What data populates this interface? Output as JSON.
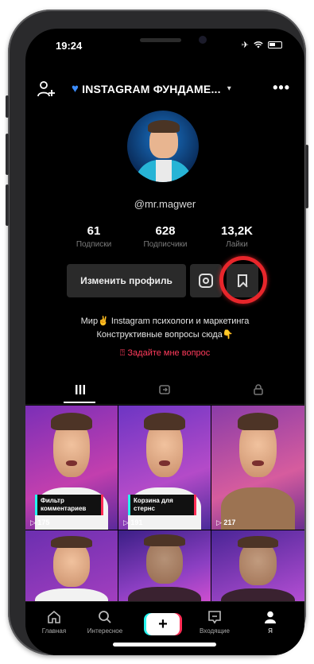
{
  "status_bar": {
    "time": "19:24"
  },
  "header": {
    "title": "INSTAGRAM ФУНДАМЕ...",
    "heart_icon": "blue-heart-emoji"
  },
  "profile": {
    "username": "@mr.magwer",
    "stats": [
      {
        "value": "61",
        "label": "Подписки"
      },
      {
        "value": "628",
        "label": "Подписчики"
      },
      {
        "value": "13,2K",
        "label": "Лайки"
      }
    ],
    "edit_button": "Изменить профиль",
    "bio_line1": "Мир✌️ Instagram психологи и маркетинга",
    "bio_line2": "Конструктивные вопросы сюда👇",
    "ask_link": "Задайте мне вопрос"
  },
  "grid": {
    "videos": [
      {
        "caption": "Фильтр комментариев",
        "views": "175"
      },
      {
        "caption": "Корзина для стернс",
        "views": "191"
      },
      {
        "caption": "",
        "views": "217"
      }
    ]
  },
  "bottom_nav": {
    "items": [
      {
        "label": "Главная",
        "icon": "home-icon"
      },
      {
        "label": "Интересное",
        "icon": "search-icon"
      },
      {
        "label": "",
        "icon": "plus-icon"
      },
      {
        "label": "Входящие",
        "icon": "inbox-icon"
      },
      {
        "label": "Я",
        "icon": "profile-icon"
      }
    ]
  },
  "colors": {
    "highlight": "#e8262b",
    "accent": "#ff3b5c",
    "tiktok_cyan": "#25f4ee",
    "tiktok_red": "#fe2c55"
  }
}
